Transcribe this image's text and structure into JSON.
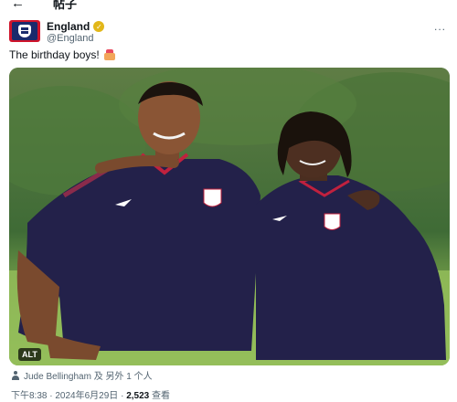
{
  "topbar": {
    "back_icon": "←",
    "title": "帖子"
  },
  "author": {
    "name": "England",
    "handle": "@England",
    "verified_icon": "gold-verified-badge-icon",
    "more_icon": "..."
  },
  "tweet": {
    "text": "The birthday boys!"
  },
  "media": {
    "alt_label": "ALT"
  },
  "tagged": {
    "text": "Jude Bellingham 及 另外 1 个人"
  },
  "meta": {
    "time": "下午8:38",
    "date": "2024年6月29日",
    "views": "2,523",
    "views_label": "查看",
    "sep": " · "
  },
  "colors": {
    "kit_navy": "#23214a",
    "brand_red": "#cf142b",
    "grass": "#8db556",
    "trees": "#3f6b36"
  }
}
